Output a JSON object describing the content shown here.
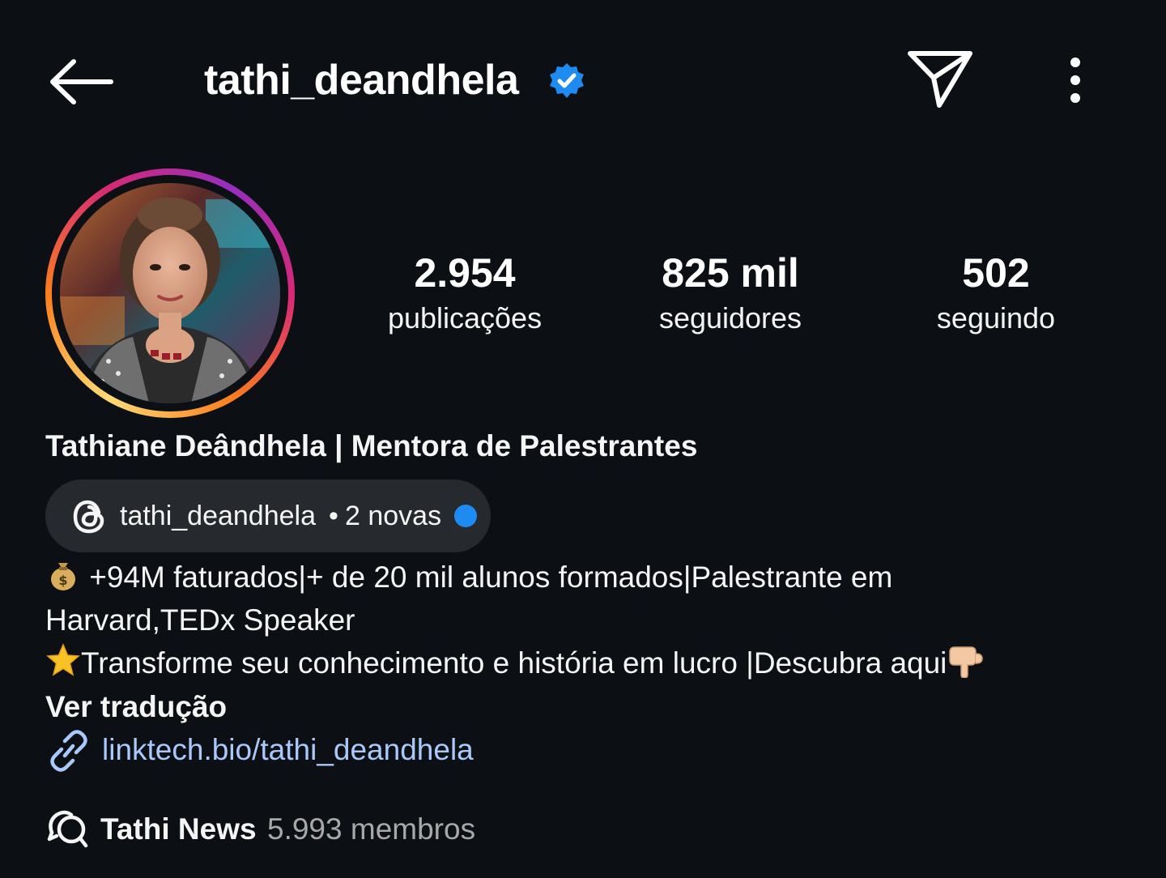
{
  "header": {
    "username": "tathi_deandhela",
    "verified": true,
    "icons": [
      "back-arrow-icon",
      "verified-badge-icon",
      "send-direct-icon",
      "more-options-icon"
    ]
  },
  "profile": {
    "avatar_description": "profile-photo",
    "stats": {
      "posts_value": "2.954",
      "posts_label": "publicações",
      "followers_value": "825 mil",
      "followers_label": "seguidores",
      "following_value": "502",
      "following_label": "seguindo"
    },
    "display_name": "Tathiane Deândhela | Mentora de Palestrantes"
  },
  "threads": {
    "handle": "tathi_deandhela",
    "separator": "•",
    "new_count": "2 novas",
    "icon": "threads-icon"
  },
  "bio": {
    "line1_emoji": "money-bag-emoji",
    "line1_text": "+94M faturados|+ de 20 mil alunos formados|Palestrante em",
    "line2_text": "Harvard,TEDx Speaker",
    "line3_emoji": "star-emoji",
    "line3_text": "Transforme seu conhecimento e história em lucro |Descubra aqui",
    "line3_end_emoji": "pointing-down-hand-emoji",
    "translate_label": "Ver tradução",
    "link_text": "linktech.bio/tathi_deandhela"
  },
  "channel": {
    "name": "Tathi News",
    "members": "5.993 membros",
    "icon": "broadcast-channel-icon"
  },
  "colors": {
    "background": "#0c1014",
    "text": "#f5f5f5",
    "link": "#a9c9fb",
    "verified_blue": "#1d8bf1",
    "pill_bg": "#262a2f",
    "muted": "#a8a8a8"
  }
}
